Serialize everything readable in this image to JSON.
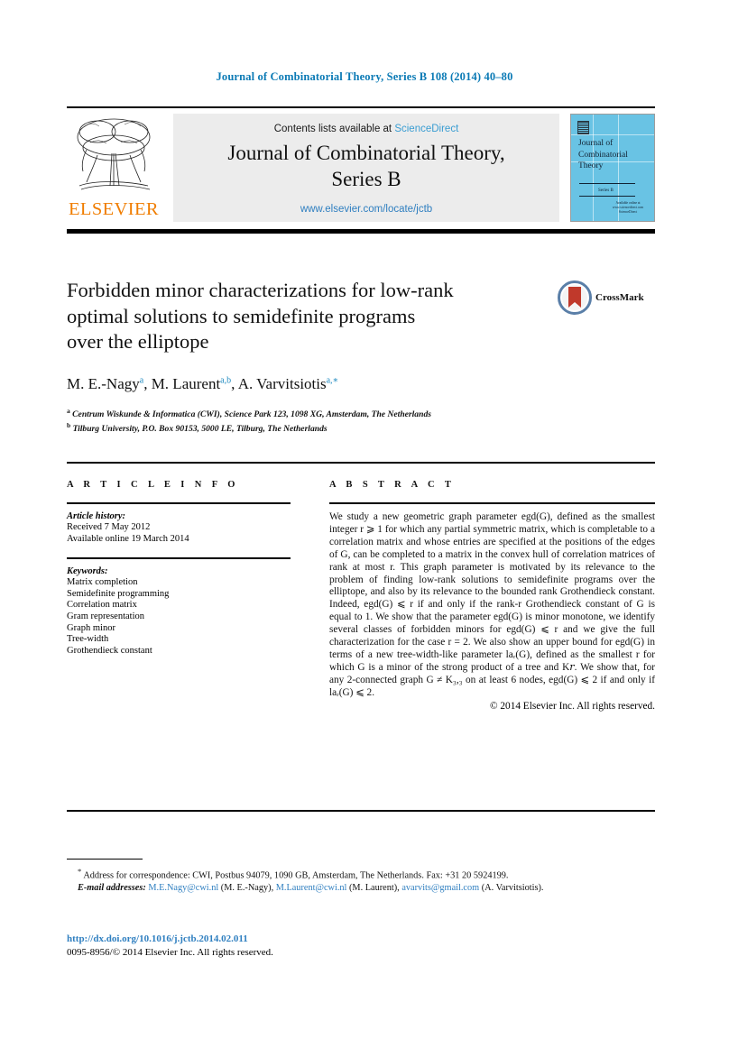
{
  "running_head": "Journal of Combinatorial Theory, Series B 108 (2014) 40–80",
  "masthead": {
    "publisher_name": "ELSEVIER",
    "contents_prefix": "Contents lists available at ",
    "sciencedirect": "ScienceDirect",
    "journal_title_line1": "Journal of Combinatorial Theory,",
    "journal_title_line2": "Series B",
    "journal_url": "www.elsevier.com/locate/jctb",
    "cover": {
      "title_line1": "Journal of",
      "title_line2": "Combinatorial",
      "title_line3": "Theory",
      "volume_label": "Series B",
      "footer_line1": "Available online at www.sciencedirect.com",
      "footer_line2": "ScienceDirect"
    }
  },
  "article": {
    "title_line1": "Forbidden minor characterizations for low-rank",
    "title_line2": "optimal solutions to semidefinite programs",
    "title_line3": "over the elliptope",
    "crossmark_label": "CrossMark",
    "authors": [
      {
        "name": "M. E.-Nagy",
        "marks": "a"
      },
      {
        "name": "M. Laurent",
        "marks": "a,b"
      },
      {
        "name": "A. Varvitsiotis",
        "marks": "a,∗"
      }
    ],
    "affiliations": [
      {
        "mark": "a",
        "text": "Centrum Wiskunde & Informatica (CWI), Science Park 123, 1098 XG, Amsterdam, The Netherlands"
      },
      {
        "mark": "b",
        "text": "Tilburg University, P.O. Box 90153, 5000 LE, Tilburg, The Netherlands"
      }
    ]
  },
  "info": {
    "heading": "A R T I C L E   I N F O",
    "history_label": "Article history:",
    "history": [
      "Received 7 May 2012",
      "Available online 19 March 2014"
    ],
    "keywords_label": "Keywords:",
    "keywords": [
      "Matrix completion",
      "Semidefinite programming",
      "Correlation matrix",
      "Gram representation",
      "Graph minor",
      "Tree-width",
      "Grothendieck constant"
    ]
  },
  "abstract": {
    "heading": "A B S T R A C T",
    "text": "We study a new geometric graph parameter egd(G), defined as the smallest integer r ⩾ 1 for which any partial symmetric matrix, which is completable to a correlation matrix and whose entries are specified at the positions of the edges of G, can be completed to a matrix in the convex hull of correlation matrices of rank at most r. This graph parameter is motivated by its relevance to the problem of finding low-rank solutions to semidefinite programs over the elliptope, and also by its relevance to the bounded rank Grothendieck constant. Indeed, egd(G) ⩽ r if and only if the rank-r Grothendieck constant of G is equal to 1. We show that the parameter egd(G) is minor monotone, we identify several classes of forbidden minors for egd(G) ⩽ r and we give the full characterization for the case r = 2. We also show an upper bound for egd(G) in terms of a new tree-width-like parameter laᵣ(G), defined as the smallest r for which G is a minor of the strong product of a tree and K𝑟. We show that, for any 2-connected graph G ≠ K₃,₃ on at least 6 nodes, egd(G) ⩽ 2 if and only if laᵣ(G) ⩽ 2.",
    "copyright": "© 2014 Elsevier Inc. All rights reserved."
  },
  "footnotes": {
    "correspondence": "Address for correspondence: CWI, Postbus 94079, 1090 GB, Amsterdam, The Netherlands. Fax: +31 20 5924199.",
    "correspondence_mark": "*",
    "email_label": "E-mail addresses:",
    "emails": [
      {
        "address": "M.E.Nagy@cwi.nl",
        "owner": "(M. E.-Nagy)"
      },
      {
        "address": "M.Laurent@cwi.nl",
        "owner": "(M. Laurent)"
      },
      {
        "address": "avarvits@gmail.com",
        "owner": "(A. Varvitsiotis)."
      }
    ]
  },
  "footer": {
    "doi": "http://dx.doi.org/10.1016/j.jctb.2014.02.011",
    "issn_line": "0095-8956/© 2014 Elsevier Inc. All rights reserved."
  },
  "colors": {
    "link_blue": "#2f7fc0",
    "header_blue": "#0b7ab5",
    "elsevier_orange": "#F07D00",
    "cover_blue": "#69c3e4",
    "band_gray": "#ececec"
  }
}
